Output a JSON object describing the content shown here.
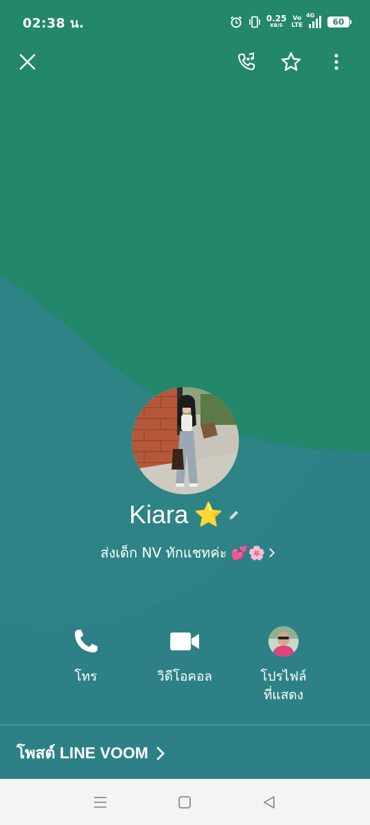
{
  "status_bar": {
    "time": "02:38 น.",
    "net_speed_value": "0.25",
    "net_speed_unit": "KB/S",
    "volte_top": "Vo",
    "volte_bottom": "LTE",
    "network_type": "4G",
    "battery": "60",
    "icons": [
      "alarm-icon",
      "vibrate-icon",
      "signal-icon"
    ]
  },
  "top_bar": {
    "icons": [
      "close-icon",
      "phone-music-icon",
      "favorite-star-icon",
      "more-vertical-icon"
    ]
  },
  "profile": {
    "name": "Kiara",
    "name_emoji": "⭐",
    "status_message": "ส่งเด็ก NV ทักแชทค่ะ 💕🌸",
    "colors": {
      "top_green": "#22876b",
      "bottom_teal": "#2e8386"
    }
  },
  "actions": [
    {
      "label": "โทร",
      "icon": "phone-icon"
    },
    {
      "label": "วิดีโอคอล",
      "icon": "video-camera-icon"
    },
    {
      "label_line1": "โปรไฟล์",
      "label_line2": "ที่แสดง",
      "icon": "profile-avatar"
    }
  ],
  "voom": {
    "label": "โพสต์ LINE VOOM",
    "icon": "chevron-right-icon"
  },
  "nav_bar": {
    "icons": [
      "recent-apps-icon",
      "home-icon",
      "back-icon"
    ]
  }
}
